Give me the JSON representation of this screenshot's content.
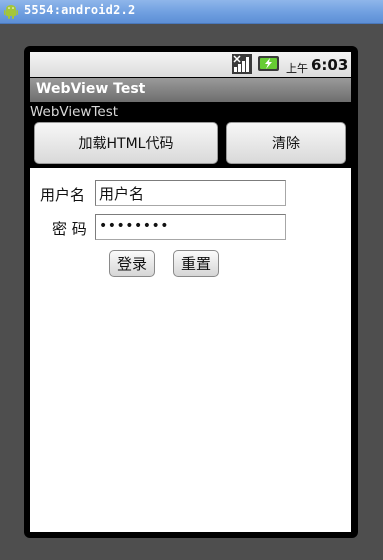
{
  "window": {
    "title": "5554:android2.2",
    "icon": "android-icon"
  },
  "status_bar": {
    "ampm": "上午",
    "time": "6:03",
    "icons": [
      "signal-icon",
      "battery-charging-icon"
    ]
  },
  "app": {
    "title": "WebView Test",
    "label": "WebViewTest",
    "buttons": {
      "load": "加载HTML代码",
      "clear": "清除"
    }
  },
  "webview": {
    "username_label": "用户名",
    "username_value": "用户名",
    "password_label": "密 码",
    "password_value": "••••••••",
    "login_label": "登录",
    "reset_label": "重置"
  },
  "colors": {
    "window_title_bar": "#6f9fe0",
    "emulator_frame": "#4e4e4e",
    "app_title_bar": "#8a8a8a",
    "activity_background": "#000000",
    "webview_background": "#ffffff"
  }
}
